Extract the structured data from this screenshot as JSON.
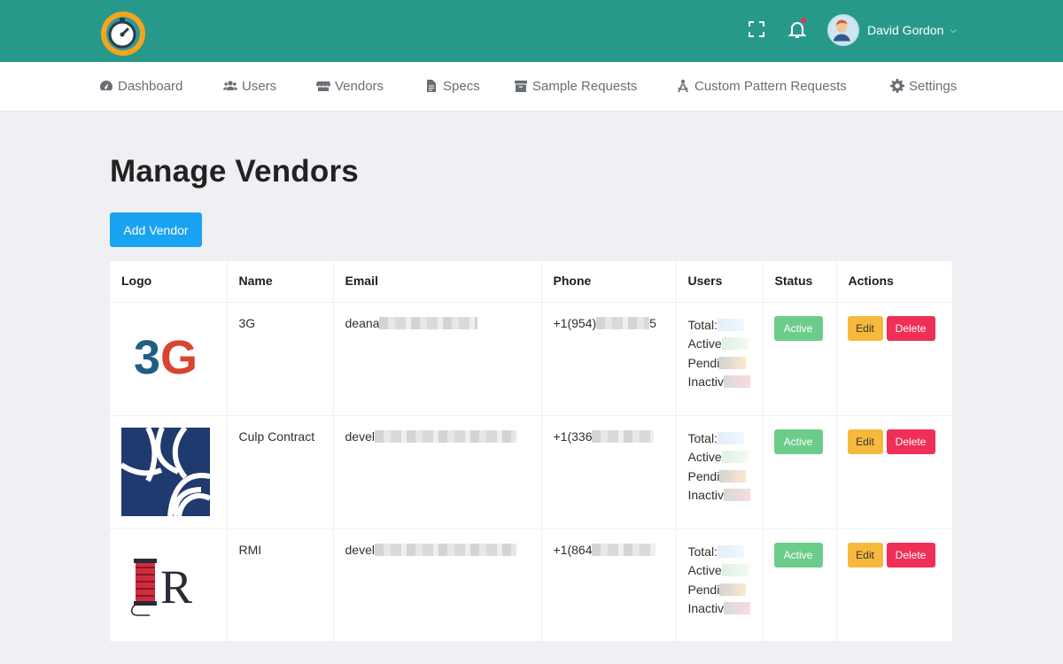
{
  "app": {
    "user_name": "David Gordon"
  },
  "nav": {
    "items": [
      {
        "label": "Dashboard",
        "icon": "tachometer-icon"
      },
      {
        "label": "Users",
        "icon": "users-icon"
      },
      {
        "label": "Vendors",
        "icon": "store-icon"
      },
      {
        "label": "Specs",
        "icon": "file-icon"
      },
      {
        "label": "Sample Requests",
        "icon": "archive-icon"
      },
      {
        "label": "Custom Pattern Requests",
        "icon": "drafting-compass-icon"
      },
      {
        "label": "Settings",
        "icon": "gear-icon"
      }
    ]
  },
  "page": {
    "title": "Manage Vendors",
    "add_button": "Add Vendor"
  },
  "table": {
    "headers": [
      "Logo",
      "Name",
      "Email",
      "Phone",
      "Users",
      "Status",
      "Actions"
    ],
    "rows": [
      {
        "name": "3G",
        "email": "deana",
        "phone_start": "+1(954)",
        "phone_end": "5",
        "status": "Active",
        "edit": "Edit",
        "delete": "Delete",
        "users": {
          "total": "Total:",
          "active": "Active",
          "pending": "Pendi",
          "inactive": "Inactiv"
        }
      },
      {
        "name": "Culp Contract",
        "email": "devel",
        "phone_start": "+1(336",
        "phone_end": "",
        "status": "Active",
        "edit": "Edit",
        "delete": "Delete",
        "users": {
          "total": "Total:",
          "active": "Active",
          "pending": "Pendi",
          "inactive": "Inactiv"
        }
      },
      {
        "name": "RMI",
        "email": "devel",
        "phone_start": "+1(864",
        "phone_end": "",
        "status": "Active",
        "edit": "Edit",
        "delete": "Delete",
        "users": {
          "total": "Total:",
          "active": "Active",
          "pending": "Pendi",
          "inactive": "Inactiv"
        }
      }
    ],
    "logos": [
      {
        "text": "3G"
      },
      {
        "text": ""
      },
      {
        "text": "R"
      }
    ]
  },
  "colors": {
    "topbar": "#27998b",
    "primary_button": "#1aa3f0",
    "status_active": "#6ccd8a",
    "edit_button": "#f7b93d",
    "delete_button": "#ef2f57"
  }
}
